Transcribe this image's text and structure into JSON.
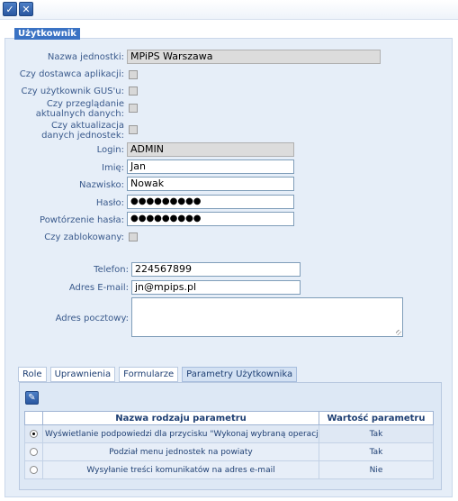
{
  "toolbar": {
    "ok_icon": "check-icon",
    "cancel_icon": "close-icon",
    "ok_glyph": "✓",
    "cancel_glyph": "✕"
  },
  "section": {
    "title": "Użytkownik"
  },
  "fields": {
    "unit": {
      "label": "Nazwa jednostki:",
      "value": "MPiPS Warszawa"
    },
    "app_vendor": {
      "label": "Czy dostawca aplikacji:",
      "checked": false
    },
    "gus_user": {
      "label": "Czy użytkownik GUS'u:",
      "checked": false
    },
    "browse_data": {
      "label": "Czy przeglądanie aktualnych danych:",
      "checked": false
    },
    "update_units": {
      "label": "Czy aktualizacja danych jednostek:",
      "checked": false
    },
    "login": {
      "label": "Login:",
      "value": "ADMIN"
    },
    "first_name": {
      "label": "Imię:",
      "value": "Jan"
    },
    "last_name": {
      "label": "Nazwisko:",
      "value": "Nowak"
    },
    "password": {
      "label": "Hasło:",
      "value": "●●●●●●●●●"
    },
    "password2": {
      "label": "Powtórzenie hasła:",
      "value": "●●●●●●●●●"
    },
    "locked": {
      "label": "Czy zablokowany:",
      "checked": false
    },
    "phone": {
      "label": "Telefon:",
      "value": "224567899"
    },
    "email": {
      "label": "Adres E-mail:",
      "value": "jn@mpips.pl"
    },
    "address": {
      "label": "Adres pocztowy:",
      "value": ""
    }
  },
  "tabs": [
    {
      "label": "Role"
    },
    {
      "label": "Uprawnienia"
    },
    {
      "label": "Formularze"
    },
    {
      "label": "Parametry Użytkownika",
      "active": true
    }
  ],
  "params_table": {
    "edit_icon": "pencil-icon",
    "edit_glyph": "✎",
    "columns": [
      "Nazwa rodzaju parametru",
      "Wartość parametru"
    ],
    "rows": [
      {
        "name": "Wyświetlanie podpowiedzi dla przycisku \"Wykonaj wybraną operację\"",
        "value": "Tak",
        "selected": true
      },
      {
        "name": "Podział menu jednostek na powiaty",
        "value": "Tak",
        "selected": false
      },
      {
        "name": "Wysyłanie treści komunikatów na adres e-mail",
        "value": "Nie",
        "selected": false
      }
    ]
  },
  "colors": {
    "accent": "#3b73c4",
    "panel": "#e6eef8",
    "label_text": "#3a5a8c"
  }
}
